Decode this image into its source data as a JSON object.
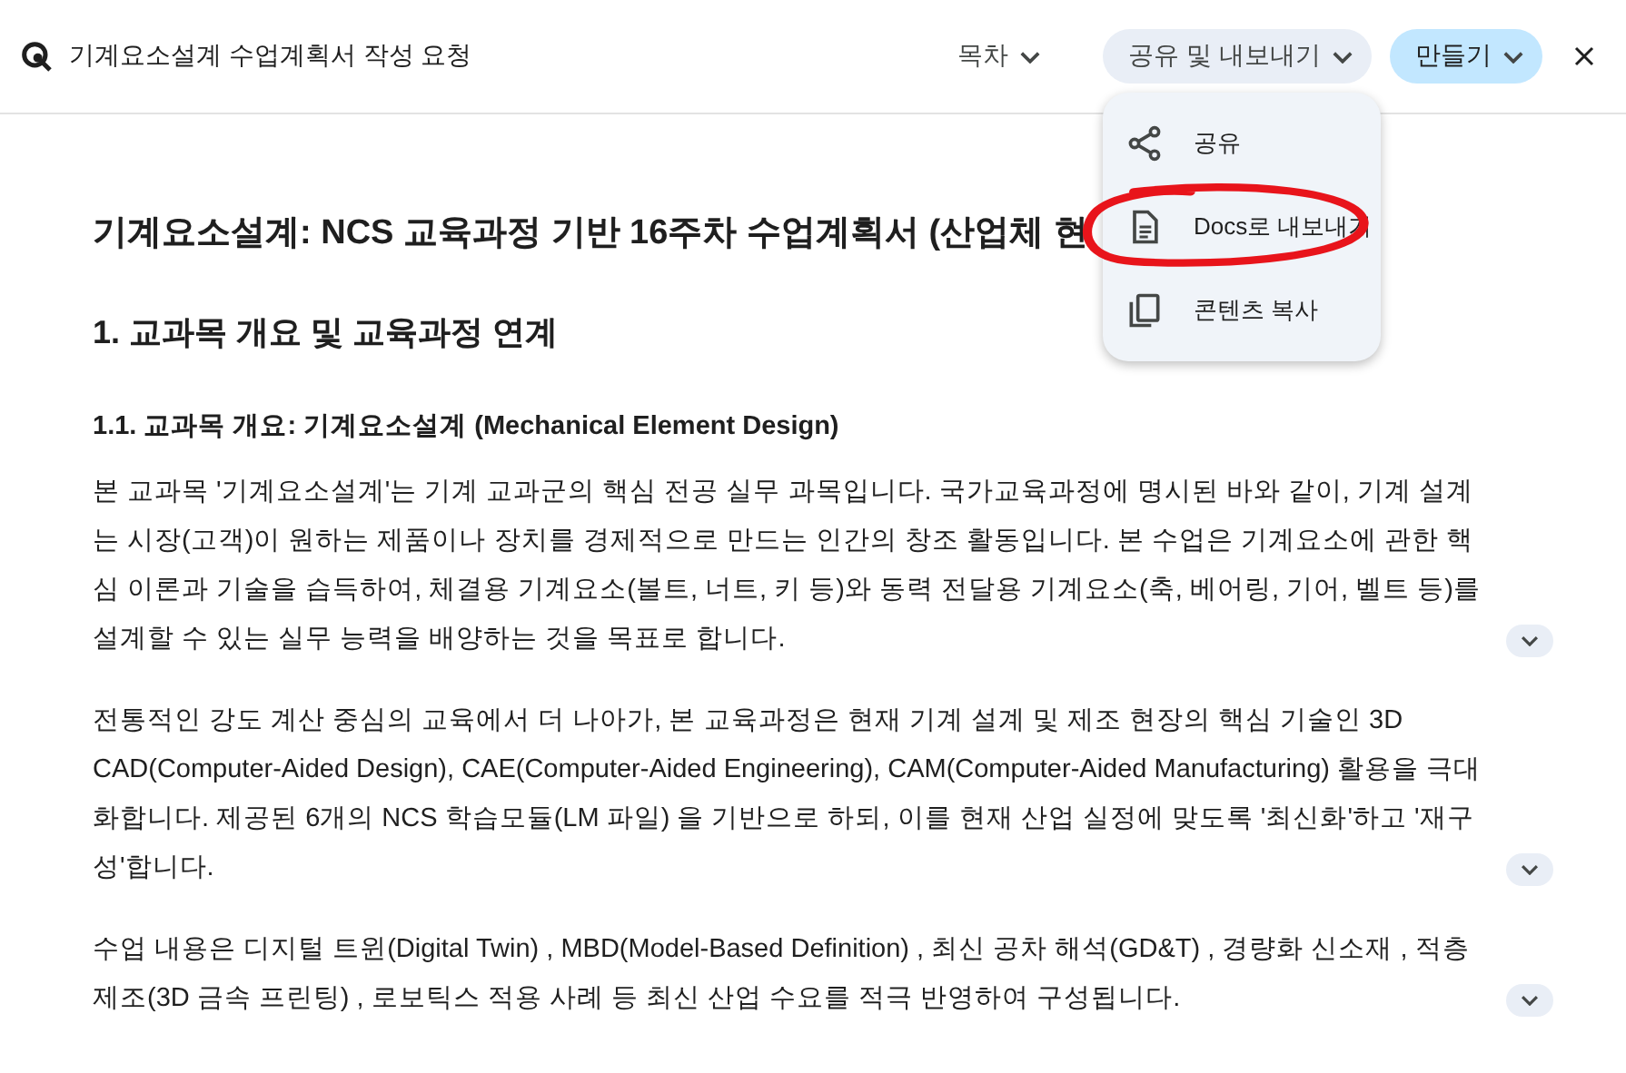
{
  "header": {
    "title": "기계요소설계 수업계획서 작성 요청",
    "toc": {
      "label": "목차"
    },
    "share_export": {
      "label": "공유 및 내보내기",
      "expanded": true
    },
    "create": {
      "label": "만들기"
    }
  },
  "menu": {
    "items": [
      {
        "kind": "share",
        "label": "공유",
        "circled": false
      },
      {
        "kind": "docs",
        "label": "Docs로 내보내기",
        "circled": true
      },
      {
        "kind": "copy",
        "label": "콘텐츠 복사",
        "circled": false
      }
    ]
  },
  "document": {
    "blocks": [
      {
        "kind": "h1",
        "text": "기계요소설계: NCS 교육과정 기반 16주차 수업계획서 (산업체 현"
      },
      {
        "kind": "h2",
        "text": "1. 교과목 개요 및 교육과정 연계"
      },
      {
        "kind": "h3",
        "text": "1.1. 교과목 개요: 기계요소설계 (Mechanical Element Design)"
      },
      {
        "kind": "p",
        "text": "본 교과목 '기계요소설계'는 기계 교과군의 핵심 전공 실무 과목입니다. 국가교육과정에 명시된 바와 같이, 기계 설계는 시장(고객)이 원하는 제품이나 장치를 경제적으로 만드는 인간의 창조 활동입니다. 본 수업은 기계요소에 관한 핵심 이론과 기술을 습득하여, 체결용 기계요소(볼트, 너트, 키 등)와 동력 전달용 기계요소(축, 베어링, 기어, 벨트 등)를 설계할 수 있는 실무 능력을 배양하는 것을 목표로 합니다.",
        "expandable": true
      },
      {
        "kind": "p",
        "text": "전통적인 강도 계산 중심의 교육에서 더 나아가, 본 교육과정은 현재 기계 설계 및 제조 현장의 핵심 기술인 3D CAD(Computer-Aided Design), CAE(Computer-Aided Engineering), CAM(Computer-Aided Manufacturing) 활용을 극대화합니다. 제공된 6개의 NCS 학습모듈(LM 파일) 을 기반으로 하되, 이를 현재 산업 실정에 맞도록 '최신화'하고 '재구성'합니다.",
        "expandable": true
      },
      {
        "kind": "p",
        "text": "수업 내용은 디지털 트윈(Digital Twin) , MBD(Model-Based Definition) , 최신 공차 해석(GD&T) , 경량화 신소재 , 적층 제조(3D 금속 프린팅) , 로보틱스 적용 사례 등 최신 산업 수요를 적극 반영하여 구성됩니다.",
        "expandable": true
      }
    ]
  }
}
